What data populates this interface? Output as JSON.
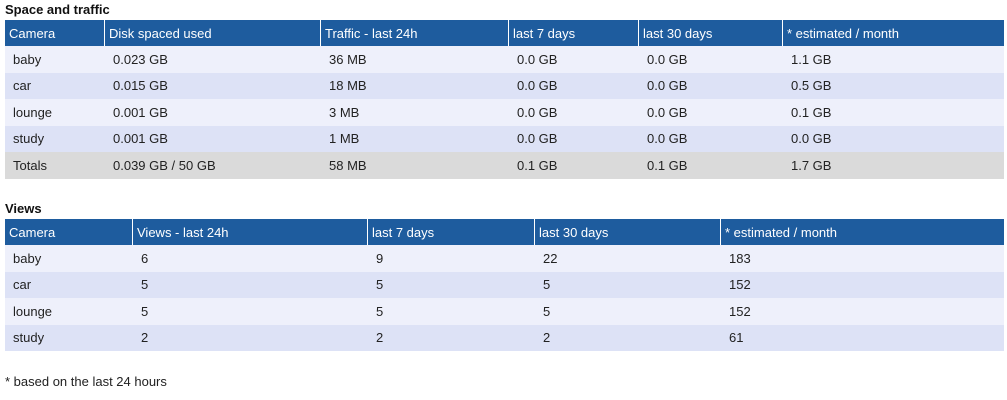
{
  "space": {
    "title": "Space and traffic",
    "headers": [
      "Camera",
      "Disk spaced used",
      "Traffic - last 24h",
      "last 7 days",
      "last 30 days",
      "* estimated / month"
    ],
    "rows": [
      [
        "baby",
        "0.023 GB",
        "36 MB",
        "0.0 GB",
        "0.0 GB",
        "1.1 GB"
      ],
      [
        "car",
        "0.015 GB",
        "18 MB",
        "0.0 GB",
        "0.0 GB",
        "0.5 GB"
      ],
      [
        "lounge",
        "0.001 GB",
        "3 MB",
        "0.0 GB",
        "0.0 GB",
        "0.1 GB"
      ],
      [
        "study",
        "0.001 GB",
        "1 MB",
        "0.0 GB",
        "0.0 GB",
        "0.0 GB"
      ]
    ],
    "totals": [
      "Totals",
      "0.039 GB / 50 GB",
      "58 MB",
      "0.1 GB",
      "0.1 GB",
      "1.7 GB"
    ]
  },
  "views": {
    "title": "Views",
    "headers": [
      "Camera",
      "Views - last 24h",
      "last 7 days",
      "last 30 days",
      "* estimated / month"
    ],
    "rows": [
      [
        "baby",
        "6",
        "9",
        "22",
        "183"
      ],
      [
        "car",
        "5",
        "5",
        "5",
        "152"
      ],
      [
        "lounge",
        "5",
        "5",
        "5",
        "152"
      ],
      [
        "study",
        "2",
        "2",
        "2",
        "61"
      ]
    ]
  },
  "footnote": "* based on the last 24 hours",
  "colors": {
    "header_bg": "#1e5c9e",
    "row_light": "#eef0fb",
    "row_dark": "#dde2f6",
    "totals_bg": "#dadada"
  }
}
